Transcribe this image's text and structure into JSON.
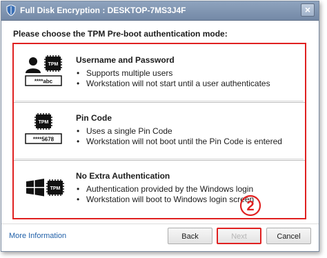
{
  "window": {
    "title": "Full Disk Encryption : DESKTOP-7MS3J4F",
    "close_label": "×"
  },
  "instruction": "Please choose the TPM Pre-boot authentication mode:",
  "options": [
    {
      "title": "Username and Password",
      "icon": "user-password-tpm-icon",
      "icon_text": "****abc",
      "chip_text": "TPM",
      "bullets": [
        "Supports multiple users",
        "Workstation will not start until a user authenticates"
      ]
    },
    {
      "title": "Pin Code",
      "icon": "pin-code-tpm-icon",
      "icon_text": "****5678",
      "chip_text": "TPM",
      "bullets": [
        "Uses a single Pin Code",
        "Workstation will not boot until the Pin Code is entered"
      ]
    },
    {
      "title": "No Extra Authentication",
      "icon": "windows-tpm-icon",
      "chip_text": "TPM",
      "bullets": [
        "Authentication provided by the Windows login",
        "Workstation will boot to Windows login screen"
      ]
    }
  ],
  "step_marker": "2",
  "footer": {
    "more_info": "More Information",
    "back": "Back",
    "next": "Next",
    "cancel": "Cancel"
  },
  "colors": {
    "highlight": "#e02020",
    "titlebar": "#7f94b1",
    "link": "#1f5fa8"
  }
}
